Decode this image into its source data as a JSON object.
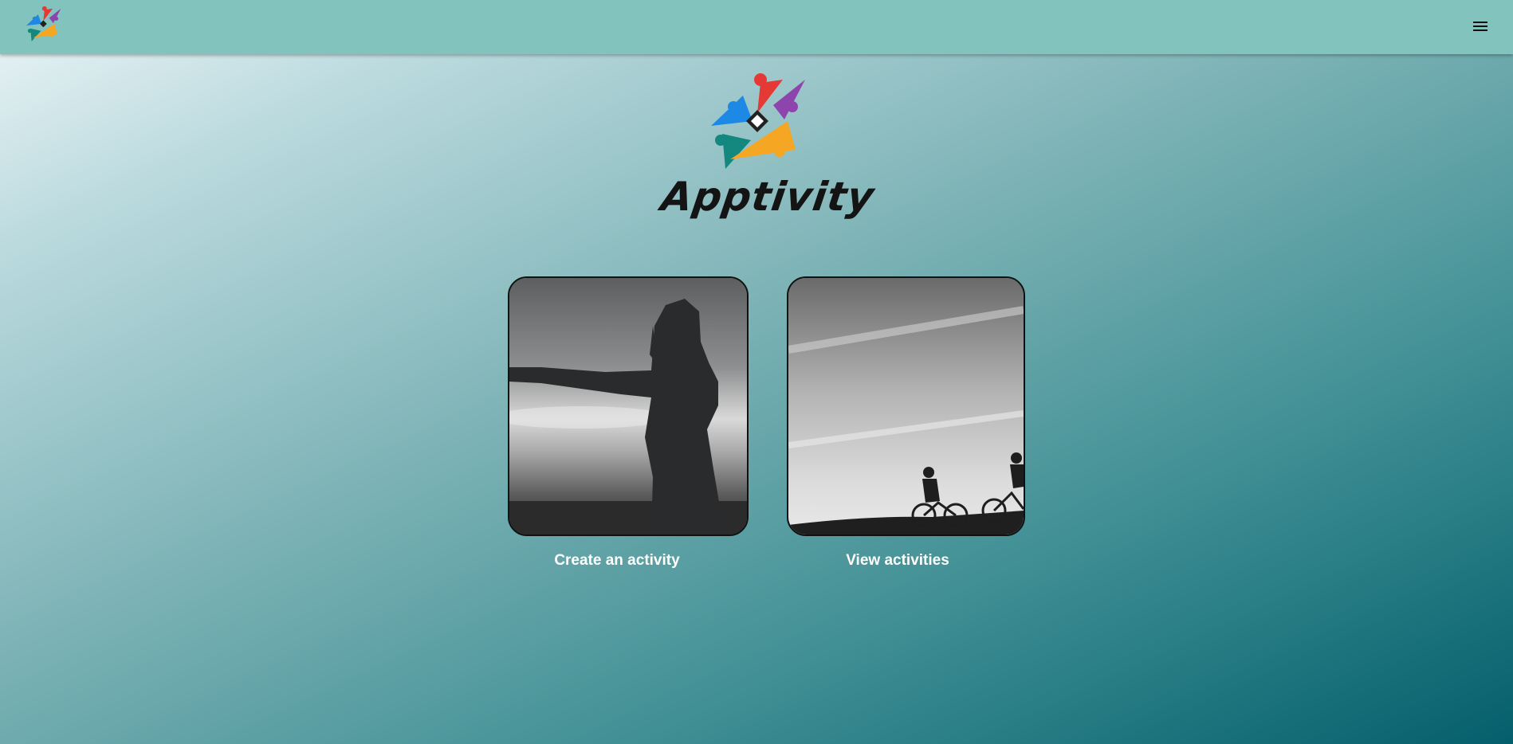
{
  "header": {
    "logo_icon": "apptivity-star-logo-icon",
    "menu_icon": "hamburger-menu-icon"
  },
  "hero": {
    "logo_icon": "apptivity-star-logo-icon",
    "wordmark": "Apptivity"
  },
  "cards": [
    {
      "label": "Create an activity",
      "image": "woman-silhouette-photo"
    },
    {
      "label": "View activities",
      "image": "cyclists-silhouette-photo"
    }
  ],
  "colors": {
    "header_bg": "#83c3bd",
    "logo_red": "#e53935",
    "logo_purple": "#8e44ad",
    "logo_blue": "#1e88e5",
    "logo_teal": "#14877f",
    "logo_orange": "#f5a623",
    "label_text": "#ffffff"
  }
}
